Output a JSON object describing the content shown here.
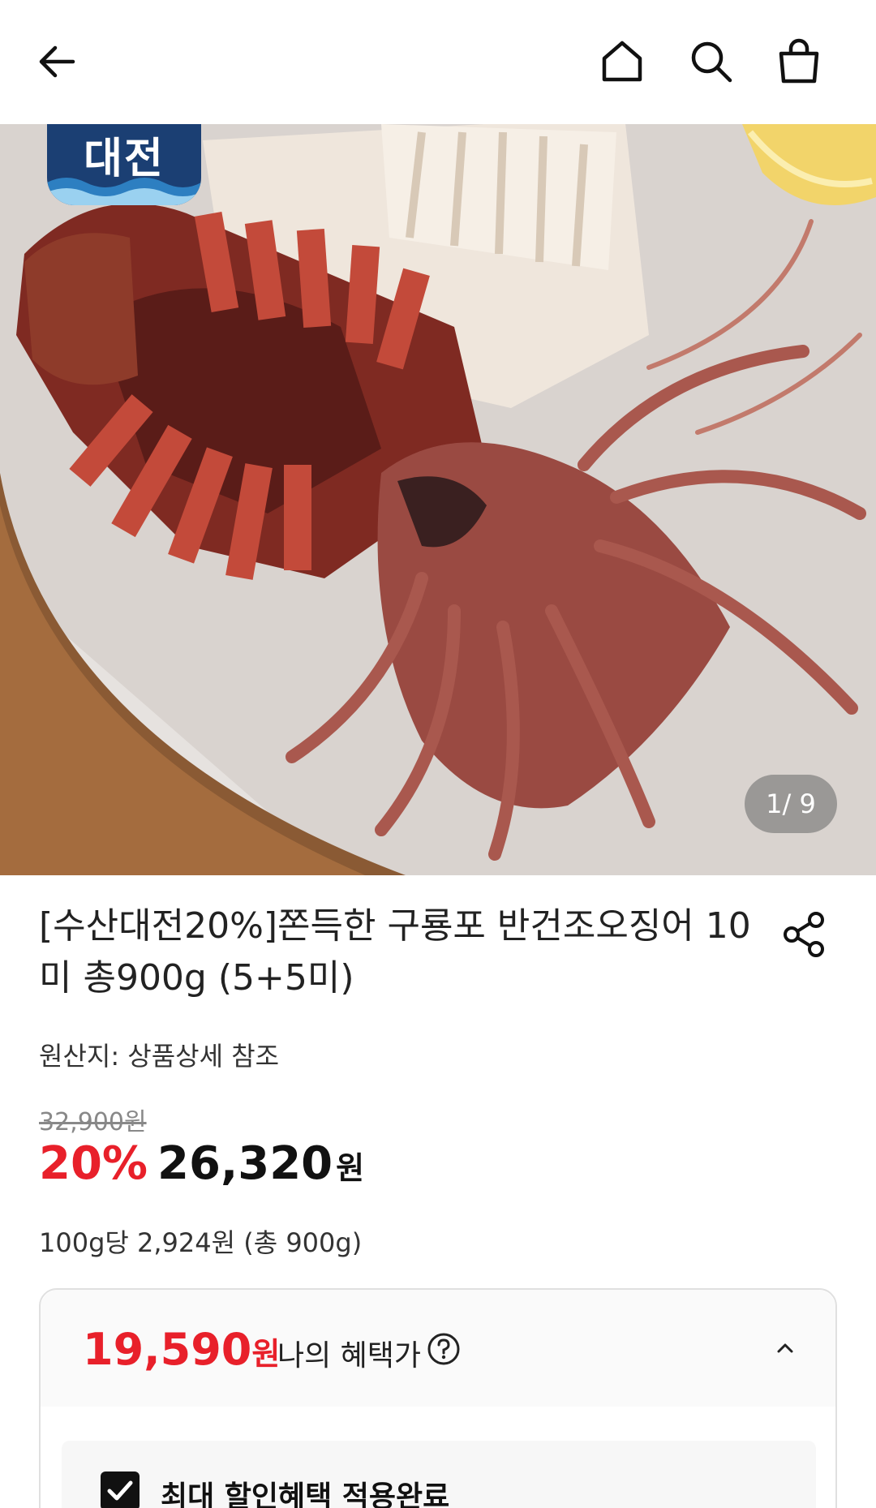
{
  "header": {
    "back_icon": "arrow-left-icon",
    "home_icon": "home-icon",
    "search_icon": "search-icon",
    "cart_icon": "shopping-bag-icon"
  },
  "hero": {
    "brand_badge": "대전",
    "pager": "1/ 9"
  },
  "product": {
    "title": "[수산대전20%]쫀득한 구룡포 반건조오징어 10미 총900g (5+5미)",
    "origin": "원산지: 상품상세 참조",
    "original_price": "32,900원",
    "discount": "20%",
    "price": "26,320",
    "price_unit": "원",
    "unit_price": "100g당 2,924원 (총 900g)"
  },
  "benefit": {
    "price": "19,590",
    "price_unit": "원",
    "label": "나의 혜택가",
    "help_icon": "question-circle-icon",
    "toggle_icon": "chevron-up-icon",
    "applied_label": "최대 할인혜택 적용완료"
  },
  "colors": {
    "accent": "#e8202a",
    "brand_badge": "#1b3f73"
  }
}
